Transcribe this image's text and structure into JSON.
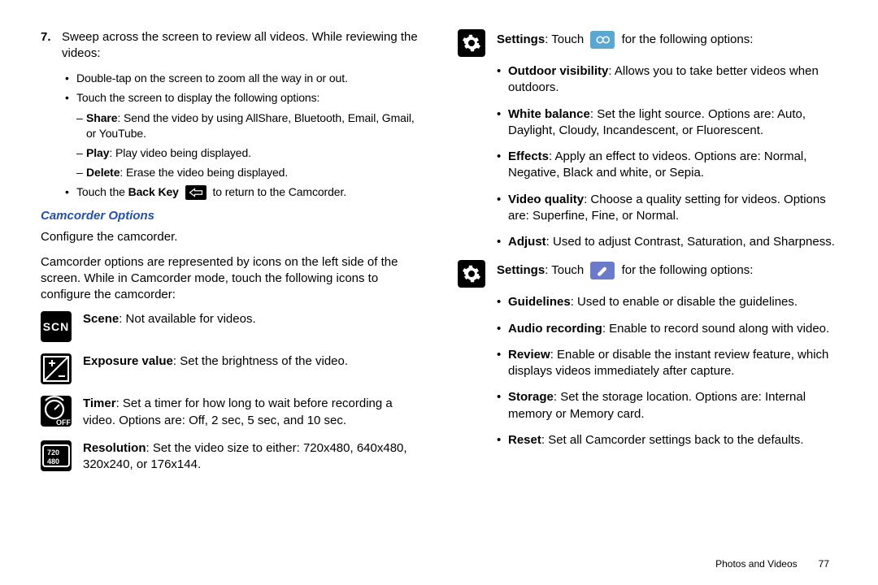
{
  "left": {
    "step7_num": "7.",
    "step7_text": "Sweep across the screen to review all videos. While reviewing the videos:",
    "b1a": "Double-tap on the screen to zoom all the way in or out.",
    "b1b": "Touch the screen to display the following options:",
    "share_label": "Share",
    "share_text": ": Send the video by using AllShare, Bluetooth, Email, Gmail, or YouTube.",
    "play_label": "Play",
    "play_text": ": Play video being displayed.",
    "delete_label": "Delete",
    "delete_text": ": Erase the video being displayed.",
    "backkey_pre": "Touch the ",
    "backkey_bold": "Back Key",
    "backkey_post": " to return to the Camcorder.",
    "section_title": "Camcorder Options",
    "configure": "Configure the camcorder.",
    "camcorder_intro": "Camcorder options are represented by icons on the left side of the screen. While in Camcorder mode, touch the following icons to configure the camcorder:",
    "scene_label": "Scene",
    "scene_text": ": Not available for videos.",
    "exposure_label": "Exposure value",
    "exposure_text": ": Set the brightness of the video.",
    "timer_label": "Timer",
    "timer_text": ": Set a timer for how long to wait before recording a video. Options are: Off, 2 sec, 5 sec, and 10 sec.",
    "resolution_label": "Resolution",
    "resolution_text": ": Set the video size to either: 720x480, 640x480, 320x240, or 176x144."
  },
  "right": {
    "settings1_pre": "Settings",
    "settings1_mid": ": Touch ",
    "settings1_post": " for the following options:",
    "s1": {
      "outdoor_l": "Outdoor visibility",
      "outdoor_t": ": Allows you to take better videos when outdoors.",
      "wb_l": "White balance",
      "wb_t": ": Set the light source. Options are: Auto, Daylight, Cloudy, Incandescent, or Fluorescent.",
      "effects_l": "Effects",
      "effects_t": ": Apply an effect to videos. Options are: Normal, Negative, Black and white, or Sepia.",
      "vq_l": "Video quality",
      "vq_t": ": Choose a quality setting for videos. Options are: Superfine, Fine, or Normal.",
      "adj_l": "Adjust",
      "adj_t": ": Used to adjust Contrast, Saturation, and Sharpness."
    },
    "settings2_pre": "Settings",
    "settings2_mid": ": Touch ",
    "settings2_post": " for the following options:",
    "s2": {
      "guide_l": "Guidelines",
      "guide_t": ": Used to enable or disable the guidelines.",
      "audio_l": "Audio recording",
      "audio_t": ": Enable to record sound along with video.",
      "review_l": "Review",
      "review_t": ": Enable or disable the instant review feature, which displays videos immediately after capture.",
      "storage_l": "Storage",
      "storage_t": ": Set the storage location. Options are: Internal memory or Memory card.",
      "reset_l": "Reset",
      "reset_t": ": Set all Camcorder settings back to the defaults."
    }
  },
  "footer": {
    "section": "Photos and Videos",
    "page": "77"
  }
}
